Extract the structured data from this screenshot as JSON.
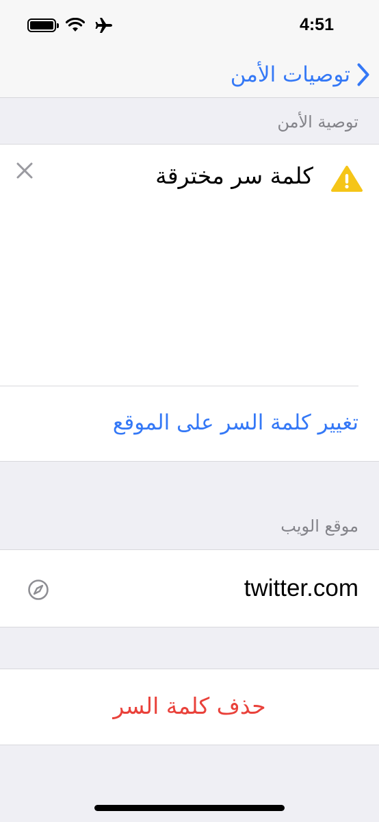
{
  "status_bar": {
    "time": "4:51",
    "icons": [
      "battery-icon",
      "wifi-icon",
      "airplane-mode-icon"
    ]
  },
  "nav": {
    "back_label": "توصيات الأمن",
    "back_icon": "chevron-right-icon"
  },
  "recommendation": {
    "section_header": "توصية الأمن",
    "title": "كلمة سر مخترقة",
    "warning_icon": "warning-triangle-icon",
    "dismiss_icon": "close-icon",
    "change_link": "تغيير كلمة السر على الموقع"
  },
  "website": {
    "section_header": "موقع الويب",
    "value": "twitter.com",
    "icon": "compass-icon"
  },
  "actions": {
    "delete_label": "حذف كلمة السر"
  },
  "colors": {
    "accent": "#3478f6",
    "destructive": "#e9413a",
    "warning": "#f5c518",
    "background": "#efeff4"
  }
}
